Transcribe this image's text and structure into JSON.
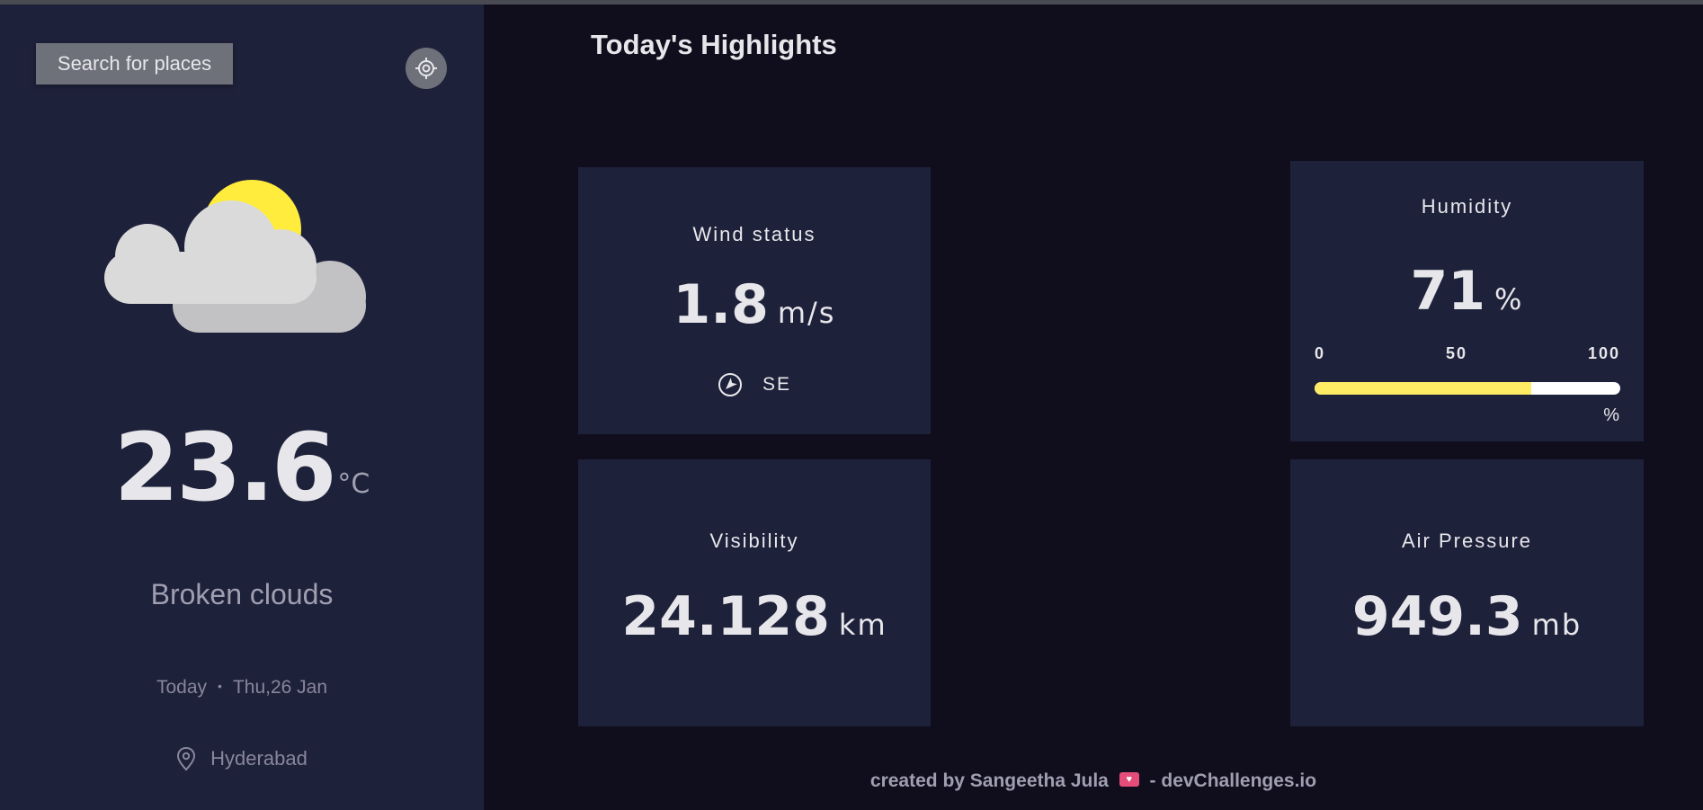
{
  "sidebar": {
    "search_label": "Search for places",
    "locate_icon": "crosshair-icon",
    "weather_icon": "partly-cloudy-icon",
    "temperature": "23.6",
    "temperature_unit": "°C",
    "condition": "Broken clouds",
    "date_prefix": "Today",
    "date_separator": "•",
    "date": "Thu,26 Jan",
    "location_icon": "map-pin-icon",
    "location": "Hyderabad"
  },
  "main": {
    "title": "Today's Highlights",
    "wind": {
      "title": "Wind status",
      "value": "1.8",
      "unit": "m/s",
      "direction_icon": "compass-arrow-icon",
      "direction": "SE"
    },
    "humidity": {
      "title": "Humidity",
      "value": "71",
      "unit": "%",
      "scale_min": "0",
      "scale_mid": "50",
      "scale_max": "100",
      "bar_unit": "%",
      "percent": 71
    },
    "visibility": {
      "title": "Visibility",
      "value": "24.128",
      "unit": "km"
    },
    "pressure": {
      "title": "Air Pressure",
      "value": "949.3",
      "unit": "mb"
    }
  },
  "footer": {
    "prefix": "created by Sangeetha Jula",
    "suffix": "- devChallenges.io"
  },
  "colors": {
    "background": "#100e1d",
    "panel": "#1e213a",
    "accent": "#ffec65"
  }
}
